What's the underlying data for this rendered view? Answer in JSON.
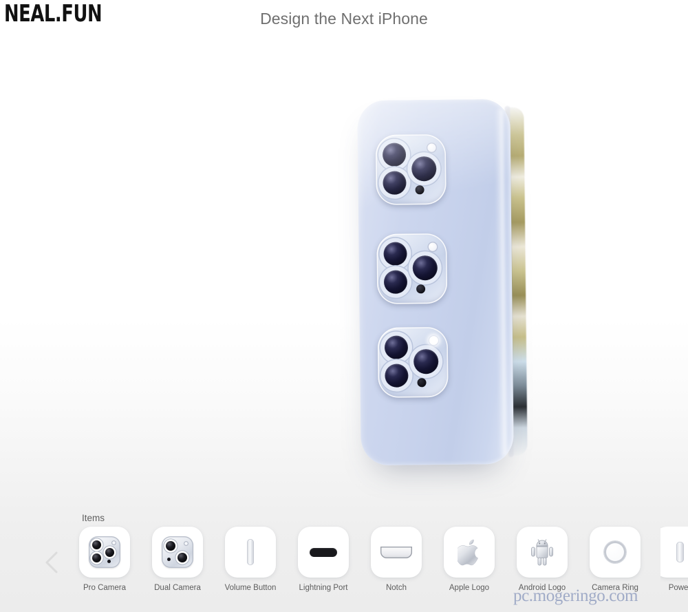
{
  "site": {
    "logo": "NEAL.FUN",
    "title": "Design the Next iPhone"
  },
  "tray": {
    "section_label": "Items",
    "prev_arrow_icon": "chevron-left-icon",
    "items": [
      {
        "label": "Pro Camera",
        "icon": "pro-camera-icon"
      },
      {
        "label": "Dual Camera",
        "icon": "dual-camera-icon"
      },
      {
        "label": "Volume Button",
        "icon": "volume-button-icon"
      },
      {
        "label": "Lightning Port",
        "icon": "lightning-port-icon"
      },
      {
        "label": "Notch",
        "icon": "notch-icon"
      },
      {
        "label": "Apple Logo",
        "icon": "apple-logo-icon"
      },
      {
        "label": "Android Logo",
        "icon": "android-logo-icon"
      },
      {
        "label": "Camera Ring",
        "icon": "camera-ring-icon"
      },
      {
        "label": "Power",
        "icon": "power-button-icon"
      }
    ]
  },
  "canvas": {
    "phone_name": "iphone-render",
    "body_color": "#c7d2ec",
    "modules": [
      {
        "name": "pro-camera-module-1",
        "flash": "dim",
        "position": "top"
      },
      {
        "name": "pro-camera-module-2",
        "flash": "dim",
        "position": "middle"
      },
      {
        "name": "pro-camera-module-3",
        "flash": "bright",
        "position": "bottom"
      }
    ]
  },
  "watermark": {
    "text": "pc.mogeringo.com"
  }
}
